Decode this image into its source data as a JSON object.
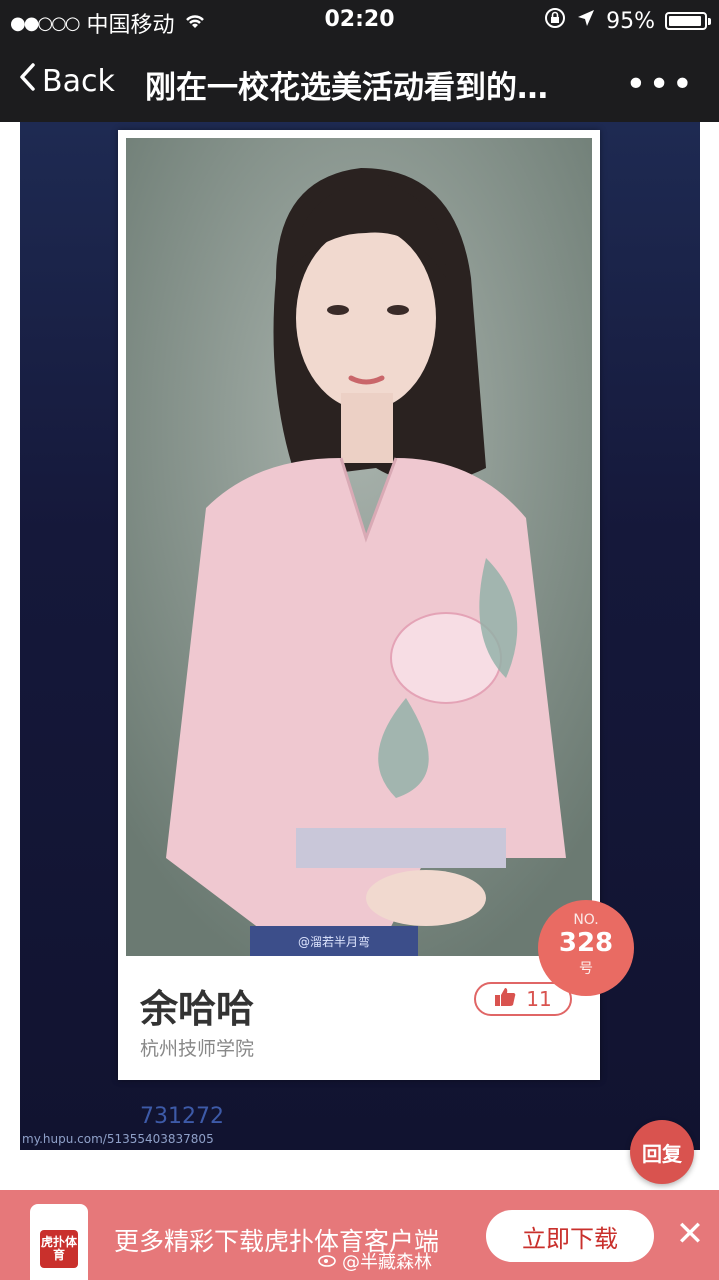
{
  "status_bar": {
    "carrier": "中国移动",
    "signal_dots": "●●○○○",
    "time": "02:20",
    "battery_percent": "95%",
    "battery_level": 0.95
  },
  "nav": {
    "back_label": "Back",
    "title": "刚在一校花选美活动看到的…",
    "more_label": "•••"
  },
  "poster": {
    "name": "余哈哈",
    "school": "杭州技师学院",
    "likes": "11",
    "badge_no": "NO.",
    "badge_number": "328",
    "badge_suffix": "号",
    "photo_watermark": "@溜若半月弯",
    "id_number": "731272",
    "source_url": "my.hupu.com/51355403837805"
  },
  "reply_button": "回复",
  "banner": {
    "app_logo_text": "虎扑体育",
    "text": "更多精彩下载虎扑体育客户端",
    "download_button": "立即下载",
    "close_label": "✕"
  },
  "weibo_watermark": "@半藏森林",
  "colors": {
    "accent_red": "#d9534f",
    "banner": "#e6787a",
    "status_bg": "#1c1c1e"
  }
}
